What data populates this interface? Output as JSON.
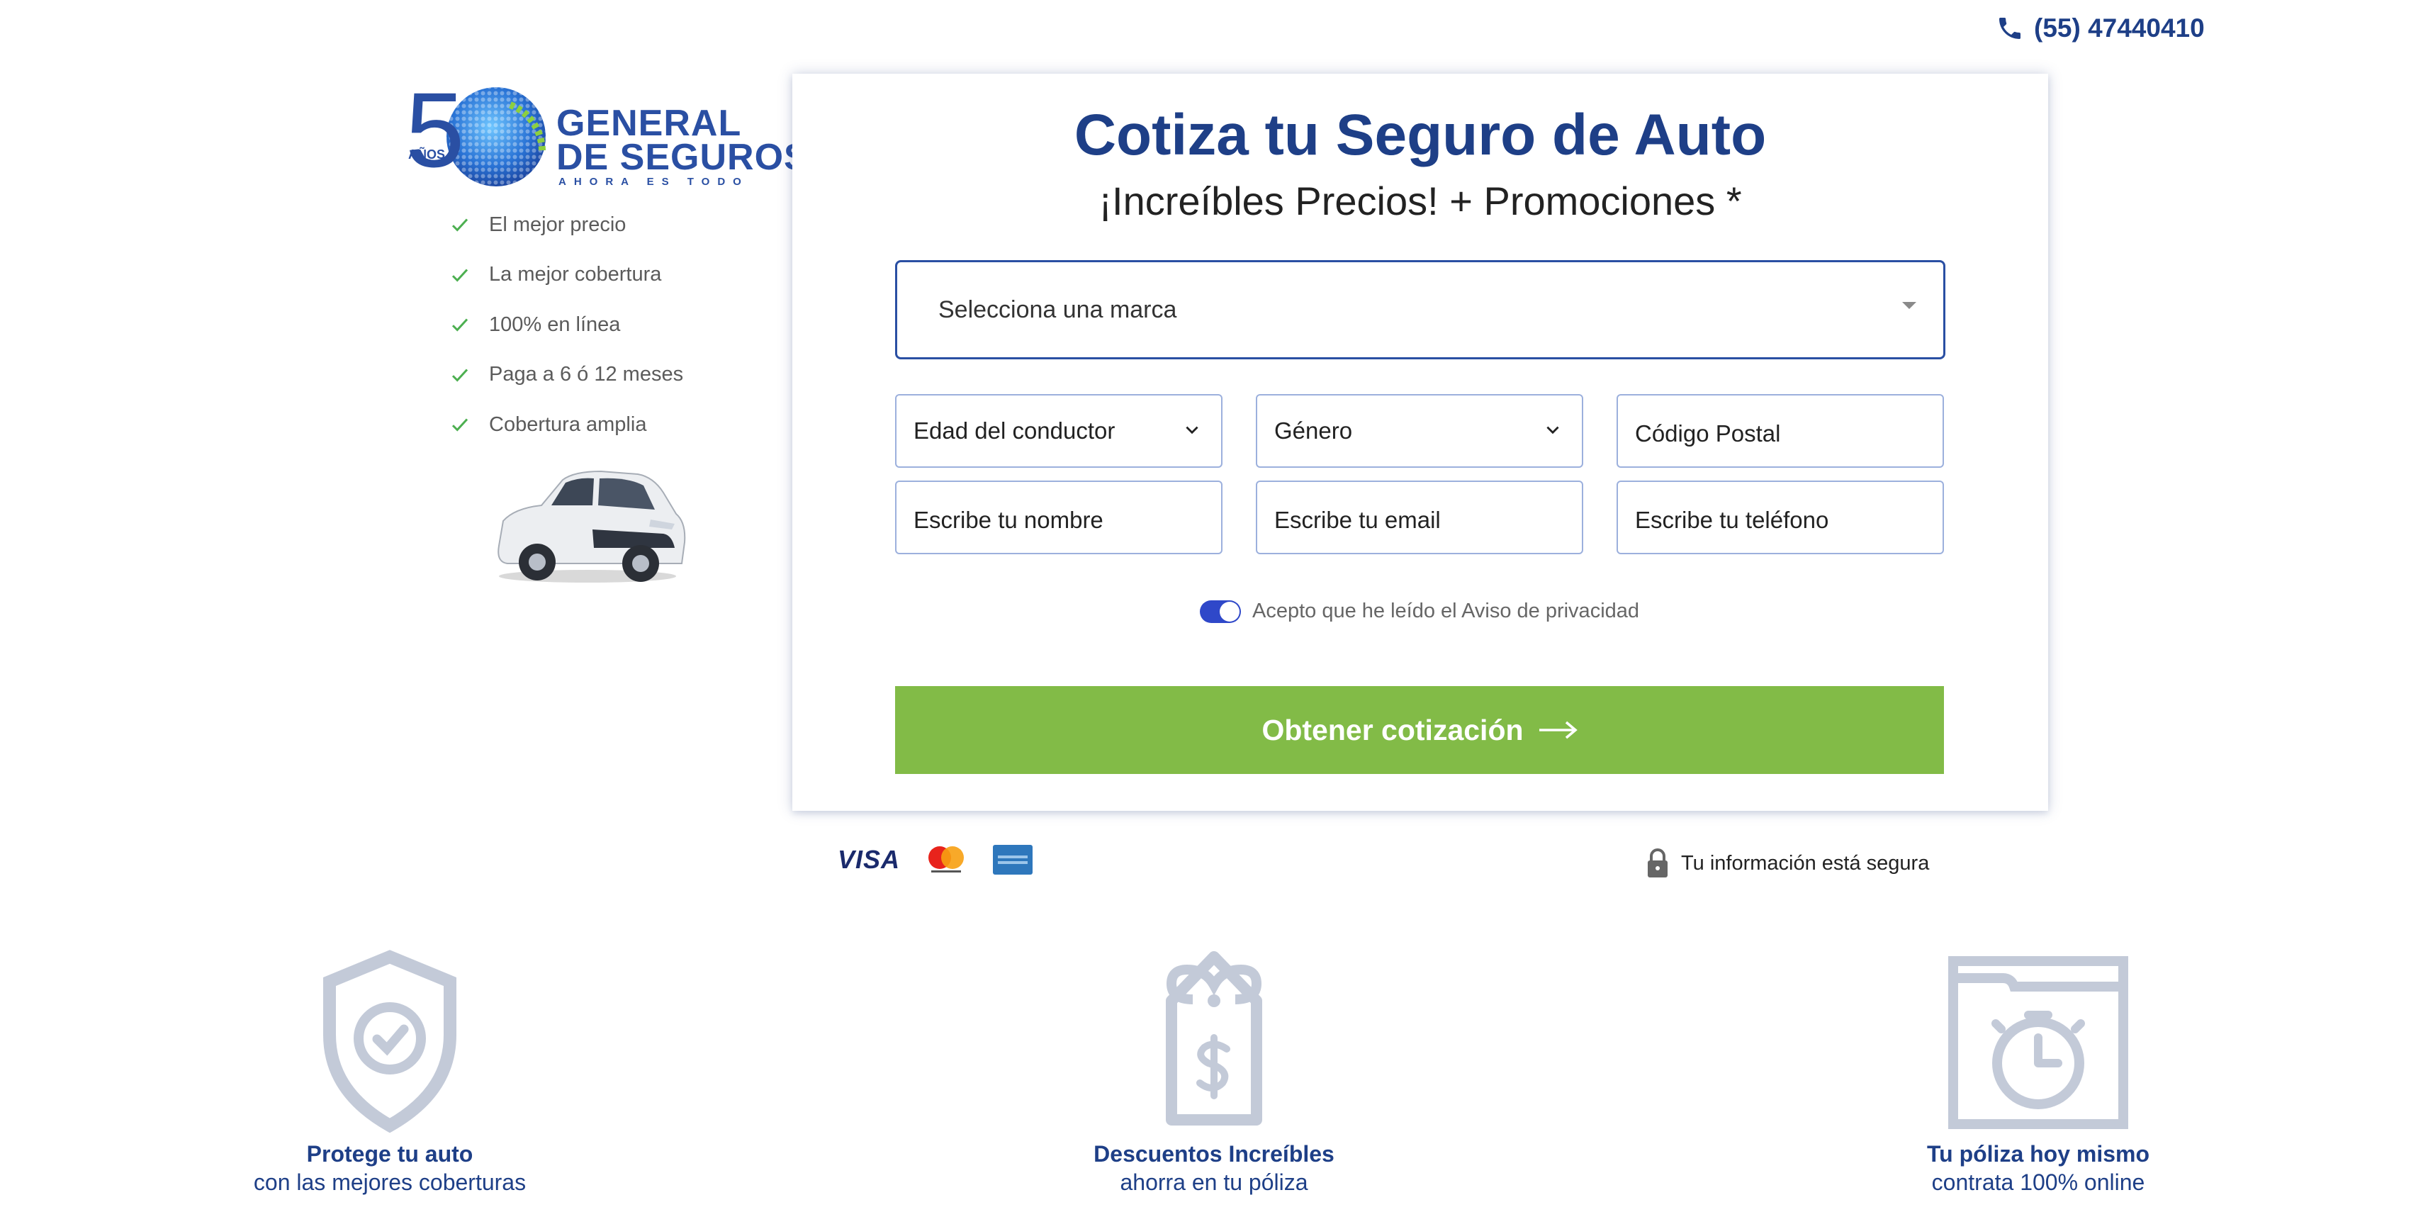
{
  "header": {
    "phone_icon": "phone-icon",
    "phone_number": "(55) 47440410"
  },
  "logo": {
    "anniversary_number": "5",
    "anniversary_word": "AÑOS",
    "line1": "GENERAL",
    "line2": "DE SEGUROS",
    "tagline": "AHORA ES TODO"
  },
  "features": [
    {
      "label": "El mejor precio",
      "icon": "check-icon"
    },
    {
      "label": "La mejor cobertura",
      "icon": "check-icon"
    },
    {
      "label": "100% en línea",
      "icon": "check-icon"
    },
    {
      "label": "Paga a 6 ó 12 meses",
      "icon": "check-icon"
    },
    {
      "label": "Cobertura amplia",
      "icon": "check-icon"
    }
  ],
  "form": {
    "title": "Cotiza tu Seguro de Auto",
    "subtitle": "¡Increíbles Precios! + Promociones *",
    "brand_select": "Selecciona una marca",
    "age_select": "Edad del conductor",
    "gender_select": "Género",
    "postal_code_placeholder": "Código Postal",
    "name_placeholder": "Escribe tu nombre",
    "email_placeholder": "Escribe tu email",
    "phone_placeholder": "Escribe tu teléfono",
    "privacy_label": "Acepto que he leído el Aviso de privacidad",
    "privacy_checked": true,
    "submit_label": "Obtener cotización",
    "submit_color": "#82bb47"
  },
  "payments": {
    "visa": "VISA",
    "icons": [
      "visa-logo",
      "mastercard-logo",
      "amex-logo"
    ]
  },
  "security": {
    "icon": "lock-icon",
    "text": "Tu información está segura"
  },
  "benefits": [
    {
      "icon": "shield-check-icon",
      "title": "Protege tu auto",
      "subtitle": "con las mejores coberturas"
    },
    {
      "icon": "price-tag-icon",
      "title": "Descuentos Increíbles",
      "subtitle": "ahorra en tu póliza"
    },
    {
      "icon": "stopwatch-folder-icon",
      "title": "Tu póliza hoy mismo",
      "subtitle": "contrata 100% online"
    }
  ],
  "colors": {
    "brand_blue": "#1e3f87",
    "cta_green": "#82bb47",
    "toggle_blue": "#2f48c9",
    "icon_gray": "#c3cad8"
  }
}
